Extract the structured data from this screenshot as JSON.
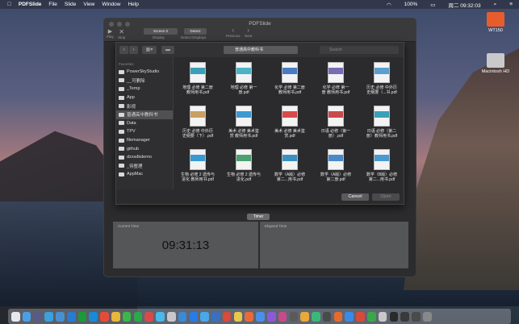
{
  "menubar": {
    "apple": "",
    "app_name": "PDFSlide",
    "items": [
      "File",
      "Slide",
      "View",
      "Window",
      "Help"
    ],
    "right": {
      "battery": "100%",
      "clock": "周二 09:32:03"
    }
  },
  "desktop_icons": [
    {
      "label": "WT150",
      "color": "#e85c2b"
    },
    {
      "label": "Macintosh HD",
      "color": "#c9c9cc"
    }
  ],
  "window": {
    "title": "PDFSlide",
    "toolbar": {
      "play": "Play",
      "stop": "Stop",
      "display_label": "Display",
      "display_value": "Screen 0",
      "detect_button": "Detect",
      "detect_label": "Detect Displays",
      "previous": "Previous",
      "next": "Next"
    },
    "timer_button": "Timer",
    "current_time_label": "Current Time",
    "current_time": "09:31:13",
    "elapsed_time_label": "Elapsed Time"
  },
  "sheet": {
    "path": "普通高中教科书",
    "search_placeholder": "Search",
    "favorites_header": "Favorites",
    "sidebar_items": [
      {
        "label": "PowerSkyStudio",
        "selected": false
      },
      {
        "label": "__可删除",
        "selected": false
      },
      {
        "label": "_Temp",
        "selected": false
      },
      {
        "label": "App",
        "selected": false
      },
      {
        "label": "影视",
        "selected": false
      },
      {
        "label": "普通高中教科书",
        "selected": true
      },
      {
        "label": "Data",
        "selected": false
      },
      {
        "label": "TPV",
        "selected": false
      },
      {
        "label": "filemanager",
        "selected": false
      },
      {
        "label": "github",
        "selected": false
      },
      {
        "label": "dzxsdkdemo",
        "selected": false
      },
      {
        "label": "_待整理",
        "selected": false
      },
      {
        "label": "AppMac",
        "selected": false
      }
    ],
    "files": [
      {
        "line1": "地理 必修 第二册",
        "line2": "教师用书.pdf",
        "color": "#3aa0b8"
      },
      {
        "line1": "地理 必修 第一",
        "line2": "册.pdf",
        "color": "#4cb2c6"
      },
      {
        "line1": "化学 必修 第二册",
        "line2": "教师用书.pdf",
        "color": "#4a7bc0"
      },
      {
        "line1": "化学 必修 第一",
        "line2": "册 教师用书.pdf",
        "color": "#7a6bb5"
      },
      {
        "line1": "历史 必修 中外历",
        "line2": "史纲要（...书.pdf",
        "color": "#5a9fd0"
      },
      {
        "line1": "历史 必修 中外历",
        "line2": "史纲要（下）.pdf",
        "color": "#c9a060"
      },
      {
        "line1": "美术 必修 美术鉴",
        "line2": "赏 教师用书.pdf",
        "color": "#3c9ad0"
      },
      {
        "line1": "美术 必修 美术鉴",
        "line2": "赏.pdf",
        "color": "#d84a4a"
      },
      {
        "line1": "日语 必修（第一",
        "line2": "册）.pdf",
        "color": "#c94a4a"
      },
      {
        "line1": "日语 必修（第二",
        "line2": "册）教师用书.pdf",
        "color": "#3aa0b8"
      },
      {
        "line1": "生物 必修 2 遗传与",
        "line2": "进化 教师用书.pdf",
        "color": "#3a9ad0"
      },
      {
        "line1": "生物 必修 2 遗传与",
        "line2": "进化.pdf",
        "color": "#4aa070"
      },
      {
        "line1": "数学（A版）必修",
        "line2": "第二...用书.pdf",
        "color": "#3a90c0"
      },
      {
        "line1": "数学（A版）必修",
        "line2": "第二册.pdf",
        "color": "#4a8ac8"
      },
      {
        "line1": "数学（B版）必修",
        "line2": "第二...用书.pdf",
        "color": "#4a9ad0"
      }
    ],
    "cancel_button": "Cancel",
    "open_button": "Open"
  }
}
